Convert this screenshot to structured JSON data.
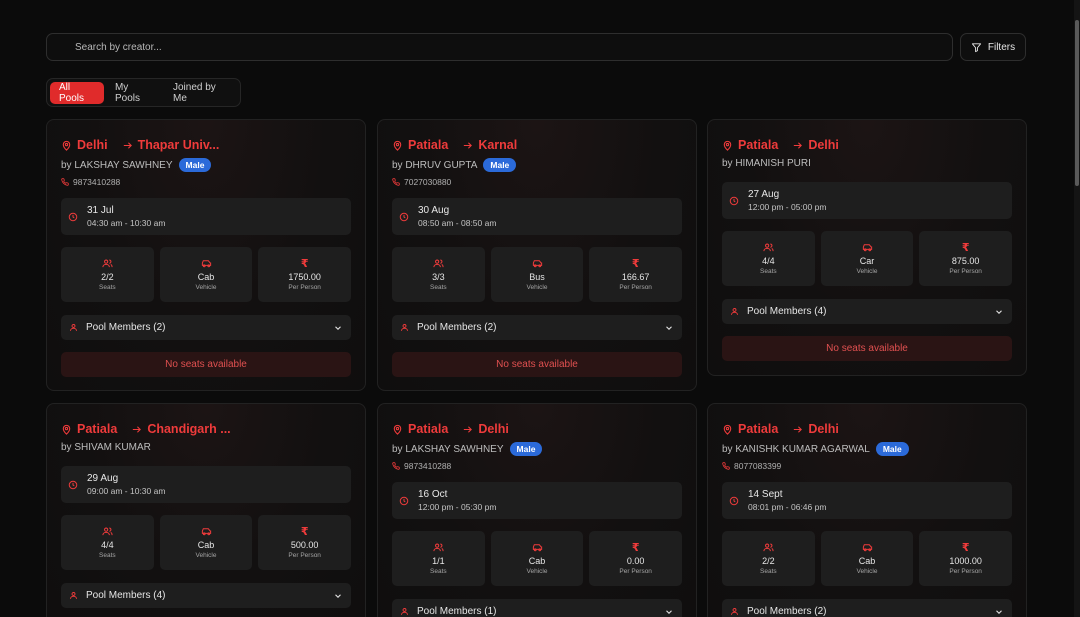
{
  "search": {
    "placeholder": "Search by creator..."
  },
  "filters": {
    "label": "Filters"
  },
  "tabs": [
    {
      "label": "All Pools"
    },
    {
      "label": "My Pools"
    },
    {
      "label": "Joined by Me"
    }
  ],
  "colors": {
    "accent": "#e02b2b",
    "badge": "#2b6ad9"
  },
  "cards": [
    {
      "from": "Delhi",
      "to": "Thapar Univ...",
      "by": "by LAKSHAY SAWHNEY",
      "badge": "Male",
      "phone": "9873410288",
      "date": "31 Jul",
      "time": "04:30 am - 10:30 am",
      "seats": "2/2",
      "seats_label": "Seats",
      "vehicle": "Cab",
      "vehicle_label": "Vehicle",
      "price": "1750.00",
      "price_label": "Per Person",
      "rupee": "₹",
      "members": "Pool Members (2)",
      "status": "No seats available"
    },
    {
      "from": "Patiala",
      "to": "Karnal",
      "by": "by DHRUV GUPTA",
      "badge": "Male",
      "phone": "7027030880",
      "date": "30 Aug",
      "time": "08:50 am - 08:50 am",
      "seats": "3/3",
      "seats_label": "Seats",
      "vehicle": "Bus",
      "vehicle_label": "Vehicle",
      "price": "166.67",
      "price_label": "Per Person",
      "rupee": "₹",
      "members": "Pool Members (2)",
      "status": "No seats available"
    },
    {
      "from": "Patiala",
      "to": "Delhi",
      "by": "by HIMANISH PURI",
      "date": "27 Aug",
      "time": "12:00 pm - 05:00 pm",
      "seats": "4/4",
      "seats_label": "Seats",
      "vehicle": "Car",
      "vehicle_label": "Vehicle",
      "price": "875.00",
      "price_label": "Per Person",
      "rupee": "₹",
      "members": "Pool Members (4)",
      "status": "No seats available"
    },
    {
      "from": "Patiala",
      "to": "Chandigarh ...",
      "by": "by SHIVAM KUMAR",
      "date": "29 Aug",
      "time": "09:00 am - 10:30 am",
      "seats": "4/4",
      "seats_label": "Seats",
      "vehicle": "Cab",
      "vehicle_label": "Vehicle",
      "price": "500.00",
      "price_label": "Per Person",
      "rupee": "₹",
      "members": "Pool Members (4)"
    },
    {
      "from": "Patiala",
      "to": "Delhi",
      "by": "by LAKSHAY SAWHNEY",
      "badge": "Male",
      "phone": "9873410288",
      "date": "16 Oct",
      "time": "12:00 pm - 05:30 pm",
      "seats": "1/1",
      "seats_label": "Seats",
      "vehicle": "Cab",
      "vehicle_label": "Vehicle",
      "price": "0.00",
      "price_label": "Per Person",
      "rupee": "₹",
      "members": "Pool Members (1)"
    },
    {
      "from": "Patiala",
      "to": "Delhi",
      "by": "by KANISHK KUMAR AGARWAL",
      "badge": "Male",
      "phone": "8077083399",
      "date": "14 Sept",
      "time": "08:01 pm - 06:46 pm",
      "seats": "2/2",
      "seats_label": "Seats",
      "vehicle": "Cab",
      "vehicle_label": "Vehicle",
      "price": "1000.00",
      "price_label": "Per Person",
      "rupee": "₹",
      "members": "Pool Members (2)"
    }
  ]
}
